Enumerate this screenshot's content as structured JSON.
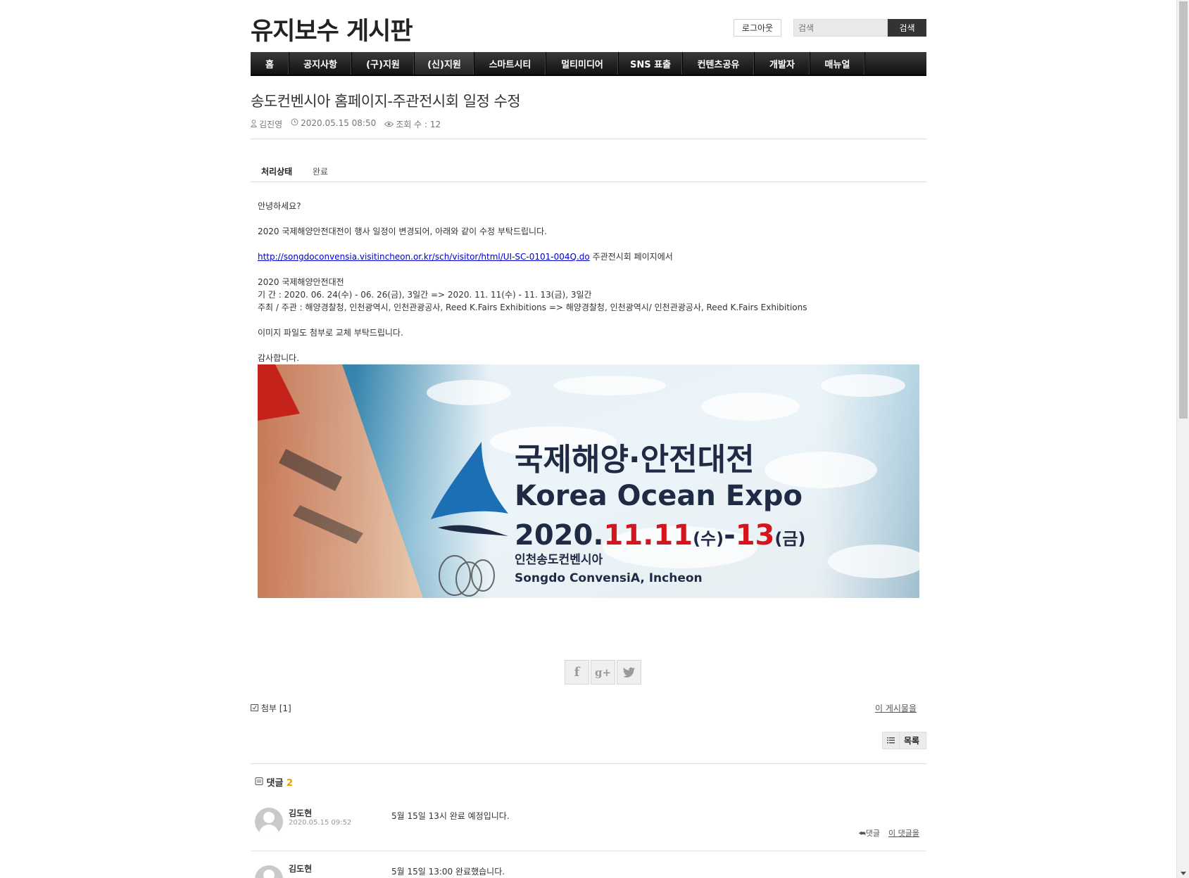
{
  "header": {
    "site_title": "유지보수 게시판",
    "logout_label": "로그아웃",
    "search_placeholder": "검색",
    "search_button": "검색"
  },
  "nav": {
    "items": [
      {
        "label": "홈"
      },
      {
        "label": "공지사항"
      },
      {
        "label": "(구)지원"
      },
      {
        "label": "(신)지원"
      },
      {
        "label": "스마트시티"
      },
      {
        "label": "멀티미디어"
      },
      {
        "label": "SNS 표출"
      },
      {
        "label": "컨텐츠공유"
      },
      {
        "label": "개발자"
      },
      {
        "label": "매뉴얼"
      }
    ],
    "active_index": 3
  },
  "post": {
    "title": "송도컨벤시아 홈페이지-주관전시회 일정 수정",
    "author": "김진영",
    "datetime": "2020.05.15 08:50",
    "views": "조회 수 : 12",
    "status_label": "처리상태",
    "status_value": "완료",
    "body": {
      "greeting": "안녕하세요?",
      "line1": "2020 국제해양안전대전이 행사 일정이 변경되어, 아래와 같이 수정 부탁드립니다.",
      "link": "http://songdoconvensia.visitincheon.or.kr/sch/visitor/html/UI-SC-0101-004Q.do",
      "link_suffix": " 주관전시회 페이지에서",
      "event_name": "2020 국제해양안전대전",
      "period": "기 간 : 2020. 06. 24(수) - 06. 26(금), 3일간 => 2020. 11. 11(수) - 11. 13(금), 3일간",
      "host": "주최 / 주관 : 해양경찰청, 인천광역시, 인천관광공사, Reed K.Fairs Exhibitions => 해양경찰청, 인천광역시/ 인천관광공사, Reed K.Fairs Exhibitions",
      "image_note": "이미지 파일도 첨부로 교체 부탁드립니다.",
      "thanks": "감사합니다."
    },
    "banner": {
      "title_ko": "국제해양·안전대전",
      "title_en": "Korea Ocean Expo",
      "date_year": "2020.",
      "date_start": "11.11",
      "date_start_day": "(수)",
      "date_dash": "-",
      "date_end": "13",
      "date_end_day": "(금)",
      "venue_ko": "인천송도컨벤시아",
      "venue_en": "Songdo ConvensiA, Incheon"
    },
    "attachments": "첨부 [1]",
    "this_post_link": "이 게시물을",
    "list_button": "목록"
  },
  "comments": {
    "label": "댓글",
    "count": "2",
    "items": [
      {
        "author": "김도현",
        "date": "2020.05.15 09:52",
        "text": "5월 15일 13시 완료 예정입니다.",
        "reply": "댓글",
        "this_comment": "이 댓글을"
      },
      {
        "author": "김도현",
        "date": "",
        "text": "5월 15일 13:00 완료했습니다."
      }
    ]
  },
  "colors": {
    "nav_bg": "#1a1a1a",
    "link": "#0000cc",
    "comment_count": "#e8a000",
    "banner_red": "#d6141b",
    "banner_navy": "#1f2a44",
    "banner_blue": "#1c6fb5"
  }
}
